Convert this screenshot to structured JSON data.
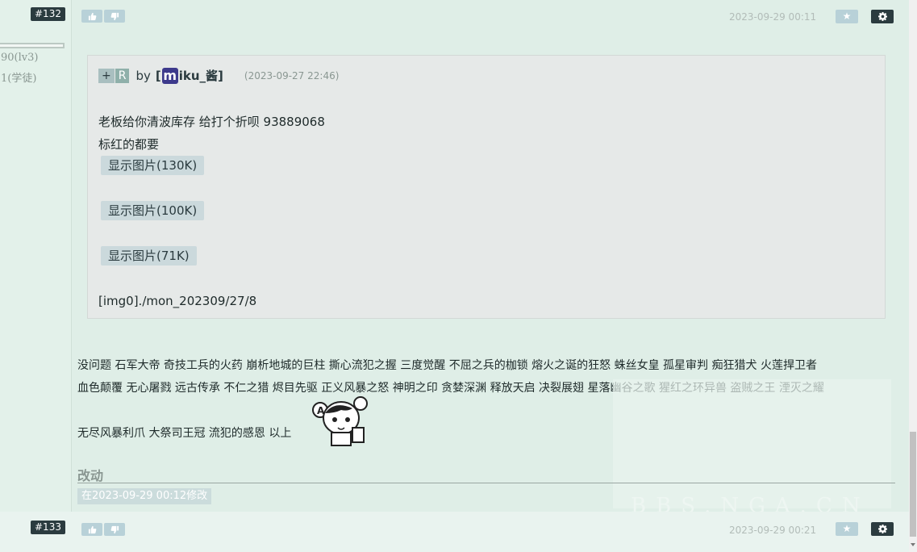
{
  "post132": {
    "number": "#132",
    "side_level": "90(lv3)",
    "side_rank": "1(学徒)",
    "timestamp": "2023-09-29 00:11",
    "quote": {
      "tag_plus": "+",
      "tag_r": "R",
      "by": "by",
      "user_prefix": "[",
      "user_initial": "m",
      "user_rest": "iku_酱]",
      "time": "(2023-09-27 22:46)",
      "line1": "老板给你清波库存 给打个折呗 93889068",
      "line2": "标红的都要",
      "images": [
        "显示图片(130K)",
        "显示图片(100K)",
        "显示图片(71K)"
      ],
      "img_tag": "[img0]./mon_202309/27/8"
    },
    "reply_line1": "没问题 石军大帝 奇技工兵的火药 崩析地城的巨柱 撕心流犯之握 三度觉醒 不屈之兵的枷锁 熔火之诞的狂怒 蛛丝女皇 孤星审判 痴狂猎犬 火莲捍卫者",
    "reply_line2": "血色颠覆 无心屠戮 远古传承 不仁之猎 烬目先驱 正义风暴之怒 神明之印 贪婪深渊 释放天启 决裂展翅 星落幽谷之歌 猩红之环异兽 盗贼之王 湮灭之耀",
    "reply_line3": "无尽风暴利爪 大祭司王冠 流犯的感恩 以上",
    "edit_title": "改动",
    "edit_note": "在2023-09-29 00:12修改"
  },
  "post133": {
    "number": "#133",
    "timestamp": "2023-09-29 00:21"
  },
  "watermark": "BBS.NGA.CN",
  "buttons": {
    "star": "★"
  }
}
